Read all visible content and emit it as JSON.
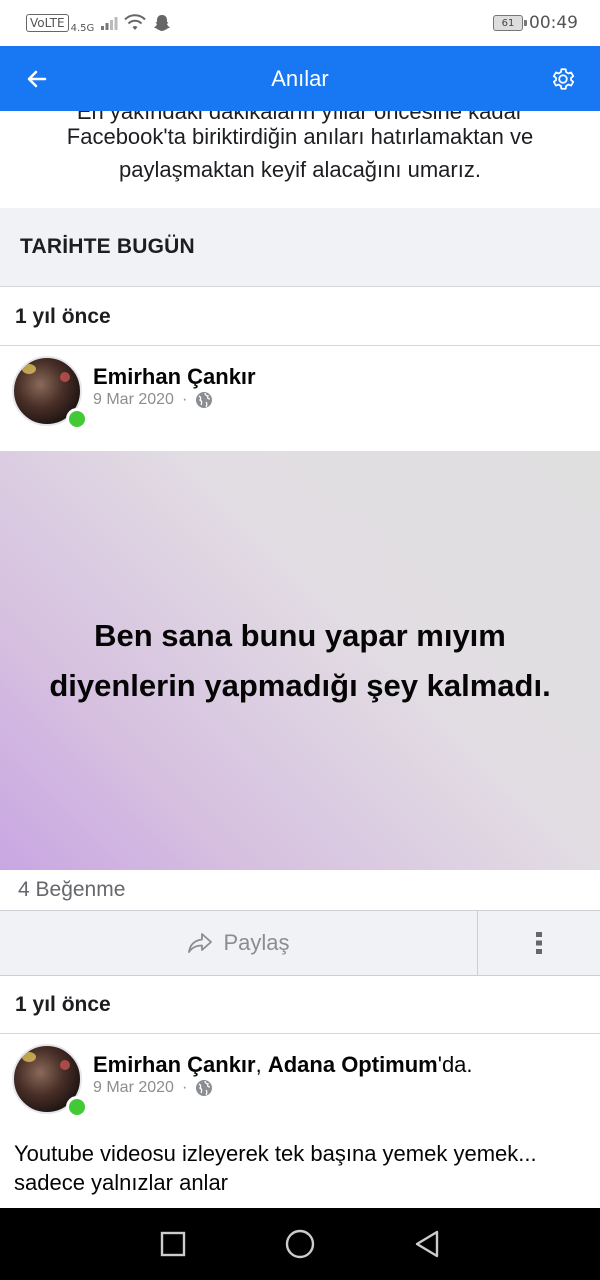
{
  "status_bar": {
    "volte": "VoLTE",
    "network": "4.5G",
    "battery": "61",
    "time": "00:49"
  },
  "app_bar": {
    "title": "Anılar"
  },
  "intro": {
    "line_cut": "En yakındaki dakikaların yıllar öncesine kadar",
    "line_1": "Facebook'ta biriktirdiğin anıları hatırlamaktan ve",
    "line_2": "paylaşmaktan keyif alacağını umarız."
  },
  "section": {
    "title": "TARİHTE BUGÜN"
  },
  "posts": [
    {
      "ago": "1 yıl önce",
      "author": "Emirhan Çankır",
      "date": "9 Mar 2020",
      "separator": "·",
      "status_line_1": "Ben sana bunu yapar mıyım",
      "status_line_2": "diyenlerin yapmadığı şey kalmadı.",
      "likes": "4 Beğenme",
      "share_label": "Paylaş"
    },
    {
      "ago": "1 yıl önce",
      "author": "Emirhan Çankır",
      "author_sep": ", ",
      "place": "Adana Optimum",
      "place_suffix": "'da.",
      "date": "9 Mar 2020",
      "separator": "·",
      "text_line_1": "Youtube videosu izleyerek tek başına yemek yemek...",
      "text_line_2": "sadece yalnızlar anlar"
    }
  ],
  "colors": {
    "brand_blue": "#1877f2",
    "online_green": "#42c935",
    "section_gray": "#f0f2f5"
  }
}
